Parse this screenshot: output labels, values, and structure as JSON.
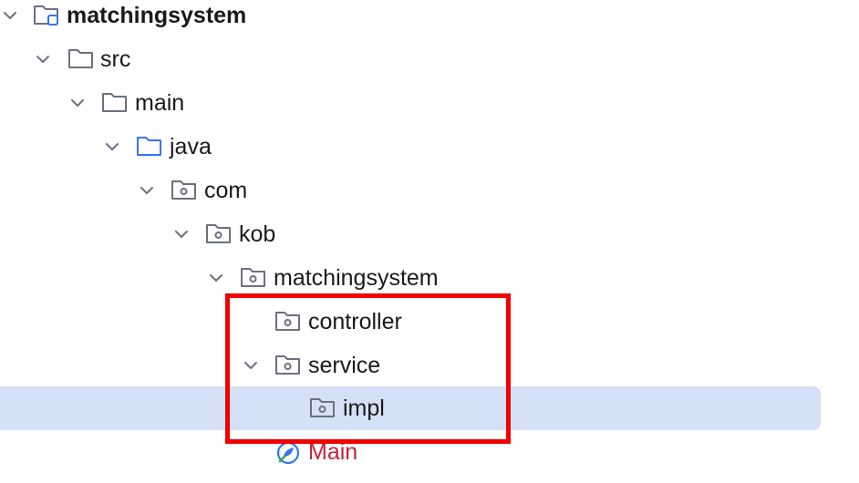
{
  "tree": {
    "project": {
      "label": "matchingsystem"
    },
    "src": {
      "label": "src"
    },
    "main": {
      "label": "main"
    },
    "java": {
      "label": "java"
    },
    "com": {
      "label": "com"
    },
    "kob": {
      "label": "kob"
    },
    "matchingsystem_pkg": {
      "label": "matchingsystem"
    },
    "controller": {
      "label": "controller"
    },
    "service": {
      "label": "service"
    },
    "impl": {
      "label": "impl"
    },
    "main_class": {
      "label": "Main"
    }
  },
  "colors": {
    "selection": "#d5e1f7",
    "highlight_border": "#f00000",
    "java_folder": "#3574f0",
    "class_name": "#c4223b"
  }
}
